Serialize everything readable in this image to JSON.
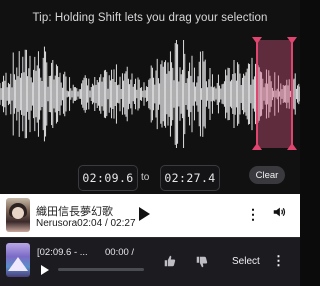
{
  "editor": {
    "tip": "Tip: Holding Shift lets you drag your selection",
    "start_time": "02:09.6",
    "to_label": "to",
    "end_time": "02:27.4",
    "clear_label": "Clear",
    "selection_color": "#e0456f"
  },
  "now_playing": {
    "title": "織田信長夢幻歌",
    "artist": "Nerusora",
    "time": "02:04 / 02:27",
    "icons": [
      "play-icon",
      "more-vertical-icon",
      "volume-icon"
    ]
  },
  "player": {
    "clip_title": "[02:09.6 - ...",
    "time": "00:00 /",
    "progress": 0.0,
    "select_label": "Select",
    "icons": [
      "play-icon",
      "thumbs-up-icon",
      "thumbs-down-icon",
      "more-vertical-icon"
    ]
  }
}
